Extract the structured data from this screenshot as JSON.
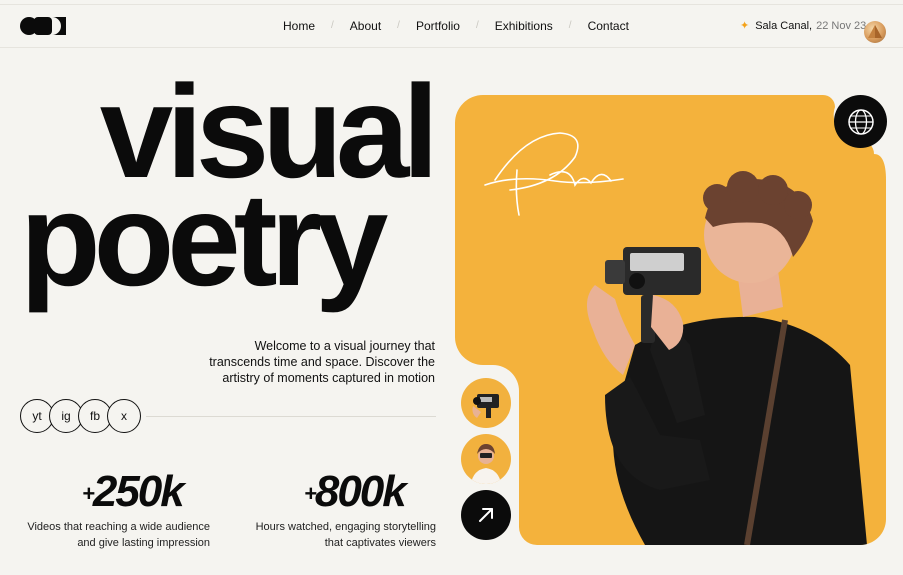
{
  "brand": {
    "logo_icon": "brand-logo-icon"
  },
  "nav": {
    "items": [
      {
        "label": "Home"
      },
      {
        "label": "About"
      },
      {
        "label": "Portfolio"
      },
      {
        "label": "Exhibitions"
      },
      {
        "label": "Contact"
      }
    ],
    "separator": "/"
  },
  "event": {
    "venue": "Sala Canal,",
    "date": "22 Nov 23",
    "icon": "star-icon"
  },
  "hero": {
    "line1": "visual",
    "line2": "poetry",
    "intro": "Welcome to a visual journey that transcends time and space. Discover the artistry of moments captured in motion",
    "signature_text": "Pedantry"
  },
  "socials": [
    {
      "label": "yt"
    },
    {
      "label": "ig"
    },
    {
      "label": "fb"
    },
    {
      "label": "x"
    }
  ],
  "stats": [
    {
      "prefix": "+",
      "value": "250k",
      "description": "Videos that reaching a wide audience and give lasting impression"
    },
    {
      "prefix": "+",
      "value": "800k",
      "description": "Hours watched, engaging storytelling that captivates viewers"
    }
  ],
  "colors": {
    "accent": "#f4b23c",
    "dark": "#0b0b0b",
    "background": "#f5f4f0"
  }
}
